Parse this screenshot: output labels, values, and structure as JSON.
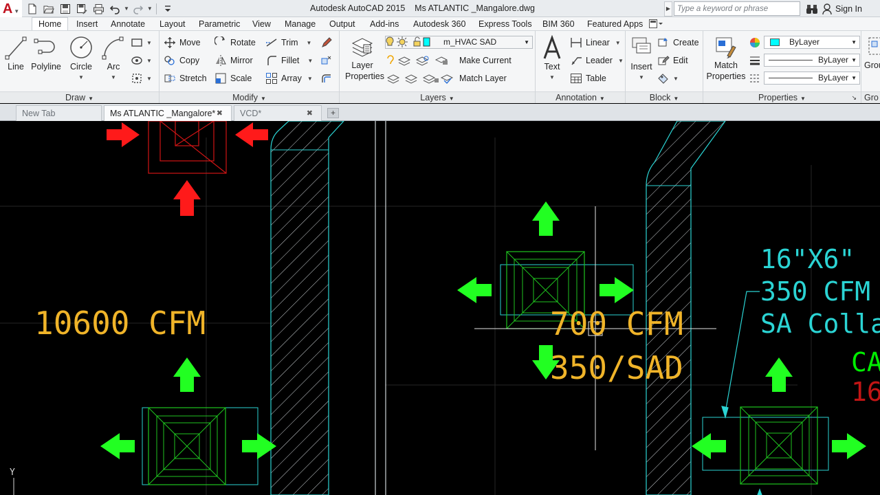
{
  "window": {
    "title": "Autodesk AutoCAD 2015    Ms ATLANTIC _Mangalore.dwg"
  },
  "app_logo": {
    "letter": "A"
  },
  "search": {
    "placeholder": "Type a keyword or phrase"
  },
  "signin": {
    "label": "Sign In"
  },
  "ribbon_tabs": [
    {
      "label": "Home",
      "active": true
    },
    {
      "label": "Insert"
    },
    {
      "label": "Annotate"
    },
    {
      "label": "Layout"
    },
    {
      "label": "Parametric"
    },
    {
      "label": "View"
    },
    {
      "label": "Manage"
    },
    {
      "label": "Output"
    },
    {
      "label": "Add-ins"
    },
    {
      "label": "Autodesk 360"
    },
    {
      "label": "Express Tools"
    },
    {
      "label": "BIM 360"
    },
    {
      "label": "Featured Apps"
    }
  ],
  "panels": {
    "draw": {
      "title": "Draw",
      "line": "Line",
      "polyline": "Polyline",
      "circle": "Circle",
      "arc": "Arc"
    },
    "modify": {
      "title": "Modify",
      "move": "Move",
      "rotate": "Rotate",
      "trim": "Trim",
      "copy": "Copy",
      "mirror": "Mirror",
      "fillet": "Fillet",
      "stretch": "Stretch",
      "scale": "Scale",
      "array": "Array"
    },
    "layers": {
      "title": "Layers",
      "layer_properties_1": "Layer",
      "layer_properties_2": "Properties",
      "current_layer": "m_HVAC SAD",
      "current_layer_color": "#00ffff",
      "make_current": "Make Current",
      "match_layer": "Match Layer"
    },
    "annotation": {
      "title": "Annotation",
      "text": "Text",
      "linear": "Linear",
      "leader": "Leader",
      "table": "Table"
    },
    "block": {
      "title": "Block",
      "insert": "Insert",
      "create": "Create",
      "edit": "Edit"
    },
    "properties": {
      "title": "Properties",
      "match_properties_1": "Match",
      "match_properties_2": "Properties",
      "color": "ByLayer",
      "color_swatch": "#00ffff",
      "linetype": "ByLayer",
      "lineweight": "ByLayer"
    },
    "groups": {
      "title": "Gro",
      "button": "Grou"
    }
  },
  "doc_tabs": [
    {
      "label": "New Tab",
      "active": false
    },
    {
      "label": "Ms ATLANTIC _Mangalore*",
      "active": true,
      "close": "✖"
    },
    {
      "label": "VCD*",
      "active": false,
      "close": "✖"
    }
  ],
  "drawing": {
    "texts": {
      "cfm_left": "10600 CFM",
      "cfm_mid": "700 CFM",
      "sad_mid": "350/SAD",
      "size_right": "16\"X6\"",
      "cfm_right": "350 CFM",
      "collar_right": "SA Colla",
      "green_right": "CA",
      "red_right": "16",
      "ucs_y": "Y"
    },
    "colors": {
      "amber_text": "#f0b429",
      "cyan": "#2bd4d4",
      "green": "#00ee00",
      "red": "#ff1a1a",
      "arrow_green": "#22ff22"
    }
  }
}
